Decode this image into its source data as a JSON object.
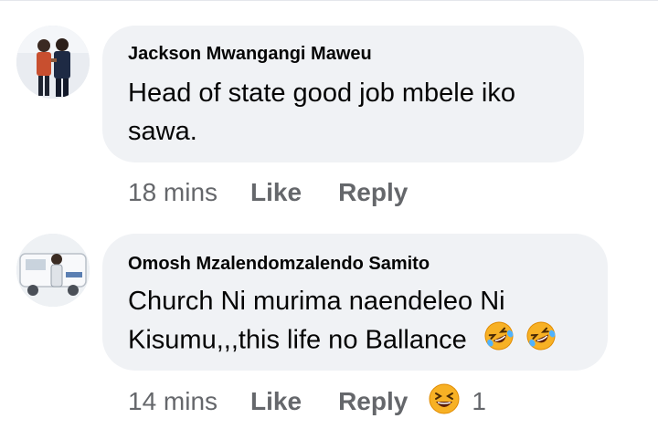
{
  "comments": [
    {
      "author": "Jackson Mwangangi Maweu",
      "text_lines": [
        "Head of state good job mbele iko",
        "sawa."
      ],
      "time": "18 mins",
      "like_label": "Like",
      "reply_label": "Reply"
    },
    {
      "author": "Omosh Mzalendomzalendo Samito",
      "text_lines": [
        "Church Ni murima naendeleo Ni",
        "Kisumu,,,this life no Ballance"
      ],
      "trailing_emojis": [
        "rolling-laughing-emoji",
        "rolling-laughing-emoji"
      ],
      "time": "14 mins",
      "like_label": "Like",
      "reply_label": "Reply",
      "reaction": {
        "icon": "laughing-emoji",
        "count": "1"
      }
    }
  ],
  "colors": {
    "bubble": "#f0f2f5",
    "text": "#050505",
    "meta": "#65676b",
    "emoji_face": "#f7b125"
  }
}
